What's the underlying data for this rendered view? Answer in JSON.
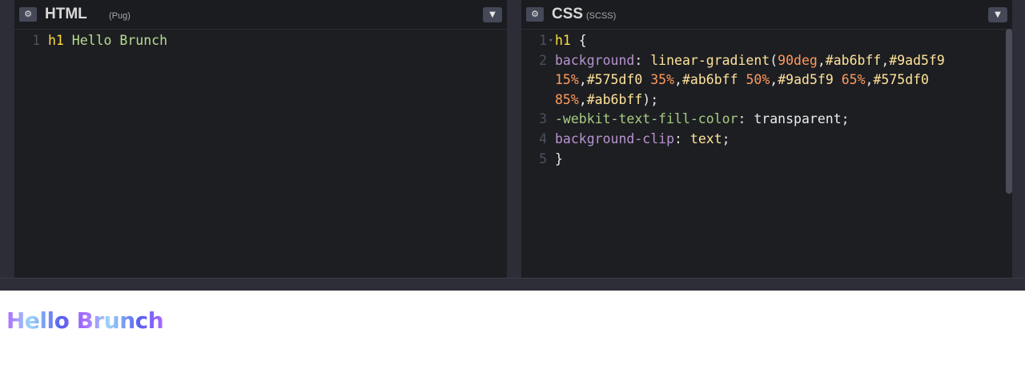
{
  "html_pane": {
    "title": "HTML",
    "subtitle": "(Pug)",
    "settings_icon": "gear-icon",
    "collapse_icon": "chevron-down-icon",
    "lines": [
      {
        "num": "1",
        "tokens": [
          {
            "t": "h1",
            "c": "k-sel"
          },
          {
            "t": " Hello Brunch",
            "c": "k-text"
          }
        ]
      }
    ]
  },
  "css_pane": {
    "title": "CSS",
    "subtitle": "(SCSS)",
    "settings_icon": "gear-icon",
    "collapse_icon": "chevron-down-icon",
    "lines": [
      {
        "num": "1",
        "fold": true,
        "tokens": [
          {
            "t": "h1",
            "c": "k-sel"
          },
          {
            "t": " {",
            "c": "k-punc"
          }
        ]
      },
      {
        "num": "2",
        "tokens": [
          {
            "t": "  background",
            "c": "k-prop"
          },
          {
            "t": ": ",
            "c": "k-punc"
          },
          {
            "t": "linear-gradient",
            "c": "k-val"
          },
          {
            "t": "(",
            "c": "k-punc"
          },
          {
            "t": "90deg",
            "c": "k-num"
          },
          {
            "t": ",",
            "c": "k-punc"
          },
          {
            "t": "#ab6bff",
            "c": "k-val"
          },
          {
            "t": ",",
            "c": "k-punc"
          },
          {
            "t": "#9ad5f9",
            "c": "k-val"
          }
        ]
      },
      {
        "num": "",
        "tokens": [
          {
            "t": "15%",
            "c": "k-num"
          },
          {
            "t": ",",
            "c": "k-punc"
          },
          {
            "t": "#575df0",
            "c": "k-val"
          },
          {
            "t": " ",
            "c": "k-punc"
          },
          {
            "t": "35%",
            "c": "k-num"
          },
          {
            "t": ",",
            "c": "k-punc"
          },
          {
            "t": "#ab6bff",
            "c": "k-val"
          },
          {
            "t": " ",
            "c": "k-punc"
          },
          {
            "t": "50%",
            "c": "k-num"
          },
          {
            "t": ",",
            "c": "k-punc"
          },
          {
            "t": "#9ad5f9",
            "c": "k-val"
          },
          {
            "t": " ",
            "c": "k-punc"
          },
          {
            "t": "65%",
            "c": "k-num"
          },
          {
            "t": ",",
            "c": "k-punc"
          },
          {
            "t": "#575df0",
            "c": "k-val"
          }
        ]
      },
      {
        "num": "",
        "tokens": [
          {
            "t": "85%",
            "c": "k-num"
          },
          {
            "t": ",",
            "c": "k-punc"
          },
          {
            "t": "#ab6bff",
            "c": "k-val"
          },
          {
            "t": ");",
            "c": "k-punc"
          }
        ]
      },
      {
        "num": "3",
        "tokens": [
          {
            "t": "  -webkit-text-fill-color",
            "c": "k-vendor"
          },
          {
            "t": ": ",
            "c": "k-punc"
          },
          {
            "t": "transparent",
            "c": "k-plain"
          },
          {
            "t": ";",
            "c": "k-punc"
          }
        ]
      },
      {
        "num": "4",
        "tokens": [
          {
            "t": "  background-clip",
            "c": "k-prop"
          },
          {
            "t": ": ",
            "c": "k-punc"
          },
          {
            "t": "text",
            "c": "k-val"
          },
          {
            "t": ";",
            "c": "k-punc"
          }
        ]
      },
      {
        "num": "5",
        "tokens": [
          {
            "t": "}",
            "c": "k-punc"
          }
        ]
      }
    ]
  },
  "preview": {
    "heading": "Hello Brunch"
  },
  "colors": {
    "editor_bg": "#1d1e22",
    "chrome_bg": "#2c2d37",
    "gradient": [
      "#ab6bff",
      "#9ad5f9",
      "#575df0",
      "#ab6bff",
      "#9ad5f9",
      "#575df0",
      "#ab6bff"
    ]
  }
}
